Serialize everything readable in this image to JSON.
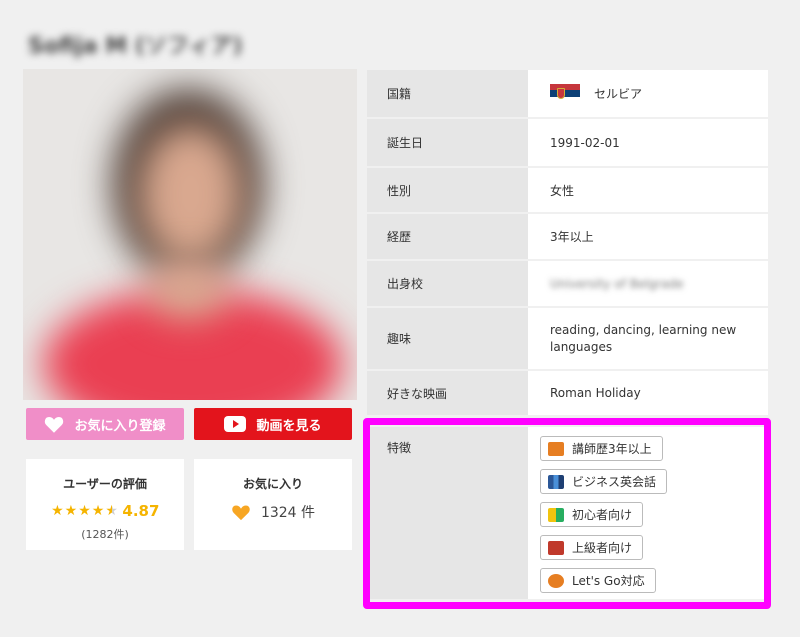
{
  "profile": {
    "name": "Sofija M (ソフィア)"
  },
  "actions": {
    "favorite_label": "お気に入り登録",
    "video_label": "動画を見る"
  },
  "rating": {
    "title": "ユーザーの評価",
    "value": "4.87",
    "count": "(1282件)",
    "stars": 4.87
  },
  "favorites": {
    "title": "お気に入り",
    "count": "1324 件"
  },
  "info": {
    "nationality_label": "国籍",
    "nationality_value": "セルビア",
    "birthday_label": "誕生日",
    "birthday_value": "1991-02-01",
    "gender_label": "性別",
    "gender_value": "女性",
    "experience_label": "経歴",
    "experience_value": "3年以上",
    "school_label": "出身校",
    "school_value": "University of Belgrade",
    "hobby_label": "趣味",
    "hobby_value": "reading, dancing, learning new languages",
    "movie_label": "好きな映画",
    "movie_value": "Roman Holiday"
  },
  "features": {
    "label": "特徴",
    "tags": [
      {
        "label": "講師歴3年以上",
        "icon": "experience-icon"
      },
      {
        "label": "ビジネス英会話",
        "icon": "books-icon"
      },
      {
        "label": "初心者向け",
        "icon": "beginner-mark-icon"
      },
      {
        "label": "上級者向け",
        "icon": "graduation-cap-icon"
      },
      {
        "label": "Let's Go対応",
        "icon": "lets-go-icon"
      }
    ]
  },
  "colors": {
    "highlight": "#ff00ff",
    "favorite_button": "#f08ec8",
    "video_button": "#e3141c",
    "star": "#f5b400"
  }
}
